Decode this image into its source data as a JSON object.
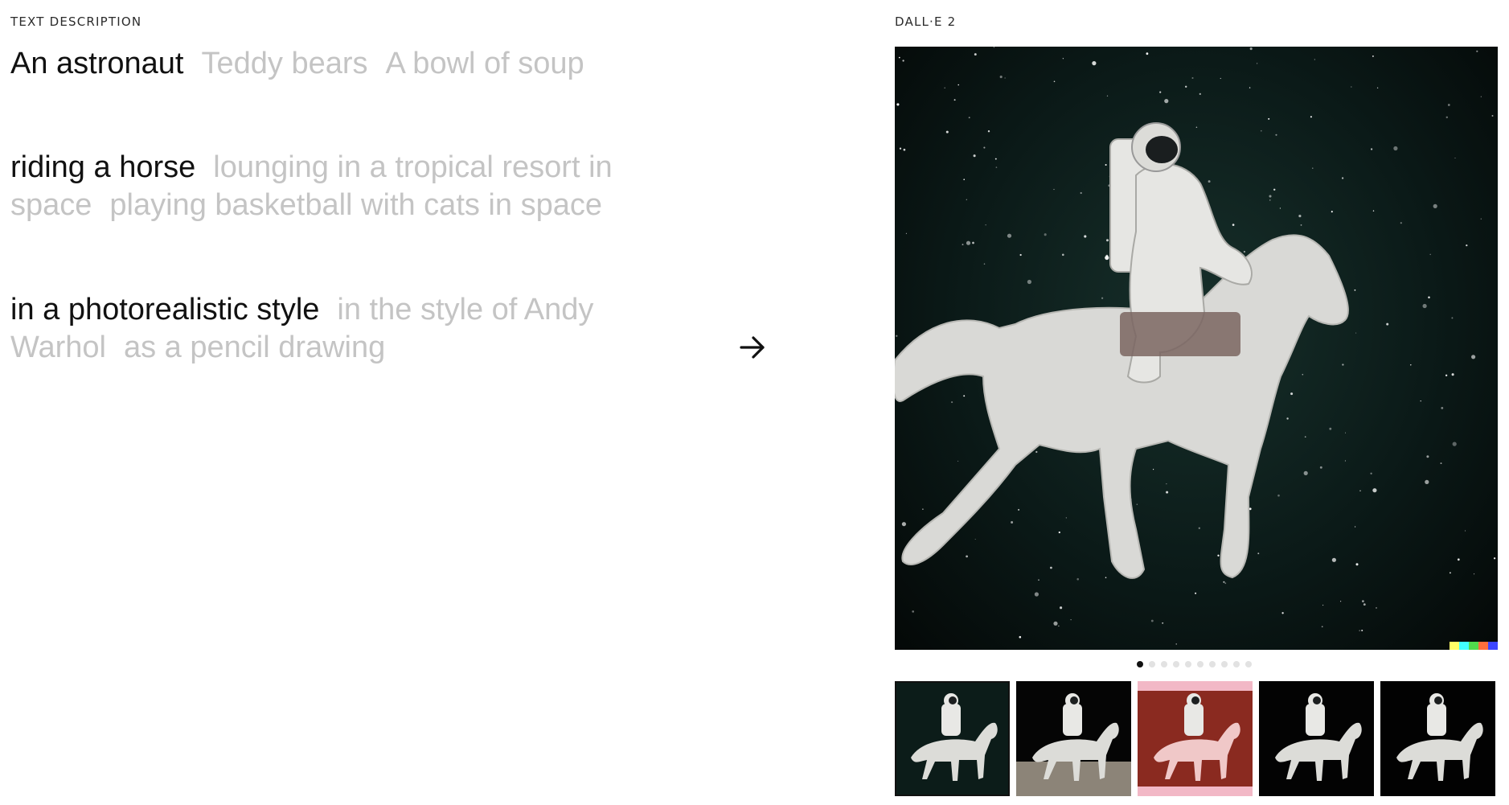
{
  "labels": {
    "left": "TEXT DESCRIPTION",
    "right": "DALL·E 2"
  },
  "prompt": {
    "subjects": [
      {
        "text": "An astronaut",
        "active": true
      },
      {
        "text": "Teddy bears",
        "active": false
      },
      {
        "text": "A bowl of soup",
        "active": false
      }
    ],
    "actions": [
      {
        "text": "riding a horse",
        "active": true
      },
      {
        "text": "lounging in a tropical resort in space",
        "active": false
      },
      {
        "text": "playing basketball with cats in space",
        "active": false
      }
    ],
    "styles": [
      {
        "text": "in a photorealistic style",
        "active": true
      },
      {
        "text": "in the style of Andy Warhol",
        "active": false
      },
      {
        "text": "as a pencil drawing",
        "active": false
      }
    ]
  },
  "generate_icon": "arrow-right-icon",
  "result": {
    "watermark_colors": [
      "#ffff66",
      "#42ffff",
      "#51da4c",
      "#ff6e3c",
      "#3c46ff"
    ],
    "pagination": {
      "total": 10,
      "current": 1
    },
    "thumbnails": [
      {
        "name": "thumbnail-1",
        "background": "#0c1c19",
        "active": true
      },
      {
        "name": "thumbnail-2",
        "background": "#050505",
        "active": false
      },
      {
        "name": "thumbnail-3",
        "background": "#8a2a20",
        "active": false
      },
      {
        "name": "thumbnail-4",
        "background": "#030303",
        "active": false
      },
      {
        "name": "thumbnail-5",
        "background": "#020202",
        "active": false
      }
    ]
  }
}
